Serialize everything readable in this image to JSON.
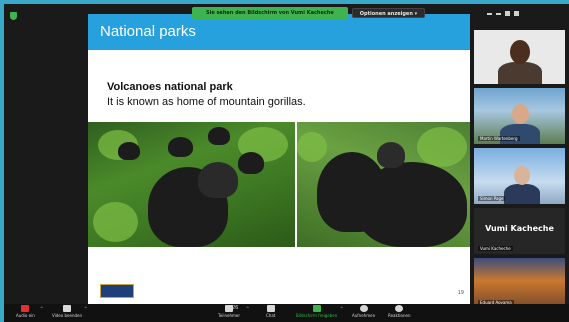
{
  "share_banner": {
    "text": "Sie sehen den Bildschirm von Vumi Kacheche",
    "options_label": "Optionen anzeigen"
  },
  "slide": {
    "title": "National parks",
    "heading": "Volcanoes national park",
    "subtitle": "It is known as home of mountain gorillas.",
    "page_number": "19"
  },
  "participants": [
    {
      "name": ""
    },
    {
      "name": "Martin Wartenberg"
    },
    {
      "name": "Simon Page"
    },
    {
      "name": "Vumi Kacheche",
      "big_name": "Vumi Kacheche"
    },
    {
      "name": "Eduard Aoyama"
    }
  ],
  "toolbar": {
    "mute_label": "Audio ein",
    "video_label": "Video beenden",
    "participants_label": "Teilnehmer",
    "participants_count": "26",
    "chat_label": "Chat",
    "share_label": "Bildschirm freigeben",
    "record_label": "Aufnehmen",
    "reactions_label": "Reaktionen"
  }
}
